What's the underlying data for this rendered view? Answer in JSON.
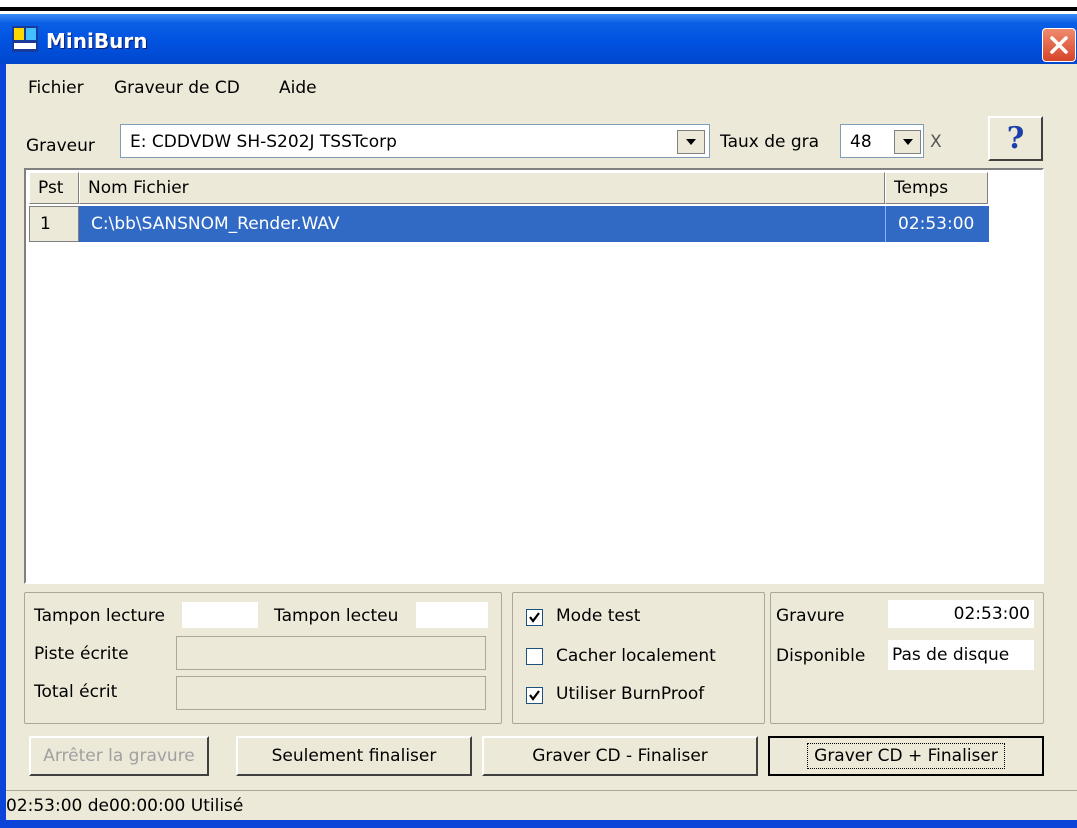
{
  "window": {
    "title": "MiniBurn"
  },
  "menu": [
    "Fichier",
    "Graveur de CD",
    "Aide"
  ],
  "burner": {
    "label": "Graveur",
    "value": "E: CDDVDW SH-S202J  TSSTcorp",
    "speed_label": "Taux de gra",
    "speed_value": "48",
    "speed_suffix": "X",
    "help_glyph": "?"
  },
  "tracklist": {
    "columns": [
      "Pst",
      "Nom Fichier",
      "Temps"
    ],
    "rows": [
      {
        "pst": "1",
        "file": "C:\\bb\\SANSNOM_Render.WAV",
        "time": "02:53:00"
      }
    ]
  },
  "buffers": {
    "read_buffer_label": "Tampon lecture",
    "writer_buffer_label": "Tampon lecteu",
    "track_written_label": "Piste écrite",
    "total_written_label": "Total écrit"
  },
  "options": [
    {
      "label": "Mode test",
      "checked": true
    },
    {
      "label": "Cacher localement",
      "checked": false
    },
    {
      "label": "Utiliser BurnProof",
      "checked": true
    }
  ],
  "summary": {
    "burn_label": "Gravure",
    "burn_value": "02:53:00",
    "available_label": "Disponible",
    "available_value": "Pas de disque"
  },
  "buttons": {
    "stop": "Arrêter la gravure",
    "finalize_only": "Seulement finaliser",
    "burn_no_finalize": "Graver CD - Finaliser",
    "burn_finalize": "Graver CD + Finaliser"
  },
  "status": "02:53:00 de00:00:00 Utilisé",
  "colors": {
    "titlebar": "#0052e0",
    "selection": "#316ac5",
    "face": "#ece9d8",
    "close": "#d6452a"
  },
  "icons": [
    "app-icon",
    "close-icon",
    "dropdown-arrow-icon",
    "help-icon",
    "checkmark-icon"
  ]
}
